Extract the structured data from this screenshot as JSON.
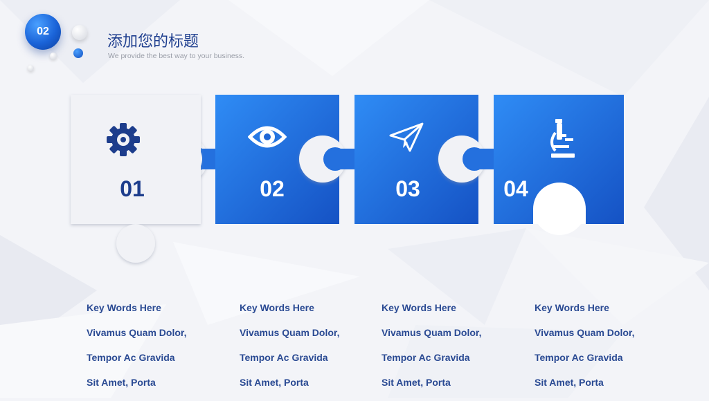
{
  "header": {
    "section_number": "02",
    "title": "添加您的标题",
    "subtitle": "We provide the best way to  your business."
  },
  "steps": [
    {
      "number": "01",
      "icon": "gear-icon"
    },
    {
      "number": "02",
      "icon": "eye-icon"
    },
    {
      "number": "03",
      "icon": "paper-plane-icon"
    },
    {
      "number": "04",
      "icon": "microscope-icon"
    }
  ],
  "columns": [
    {
      "lines": [
        "Key Words Here",
        "Vivamus Quam Dolor,",
        "Tempor Ac Gravida",
        "Sit Amet, Porta"
      ]
    },
    {
      "lines": [
        "Key Words Here",
        "Vivamus Quam Dolor,",
        "Tempor Ac Gravida",
        "Sit Amet, Porta"
      ]
    },
    {
      "lines": [
        "Key Words Here",
        "Vivamus Quam Dolor,",
        "Tempor Ac Gravida",
        "Sit Amet, Porta"
      ]
    },
    {
      "lines": [
        "Key Words Here",
        "Vivamus Quam Dolor,",
        "Tempor Ac Gravida",
        "Sit Amet, Porta"
      ]
    }
  ],
  "colors": {
    "accent": "#1a63d8",
    "accent_dark": "#1d3d8c",
    "puzzle_light": "#f1f2f6",
    "text": "#2a4a93"
  }
}
